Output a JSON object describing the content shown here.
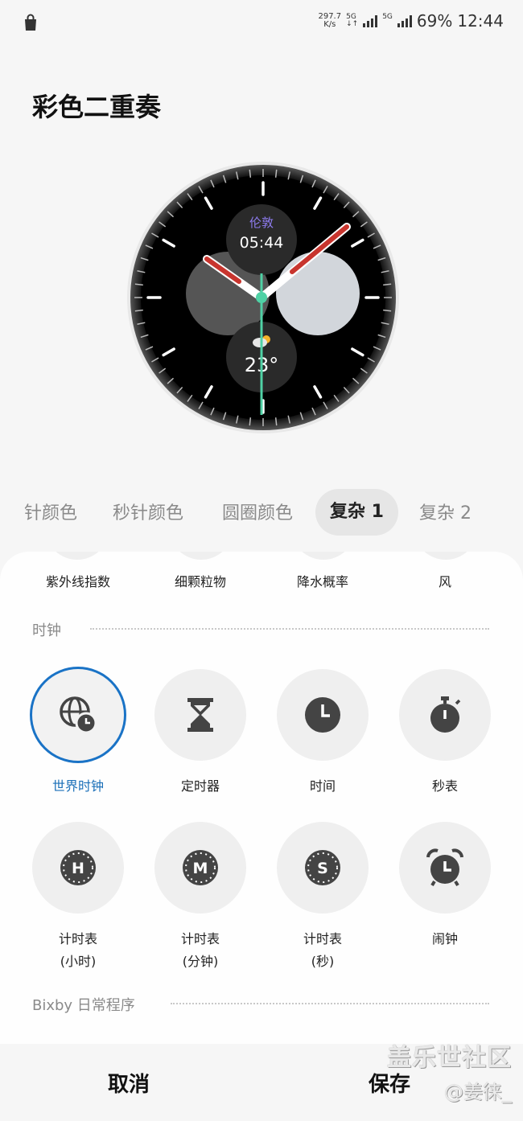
{
  "status_bar": {
    "speed_value": "297.7",
    "speed_unit": "K/s",
    "net1": "5G",
    "net2": "5G",
    "battery": "69%",
    "time": "12:44"
  },
  "page": {
    "title": "彩色二重奏"
  },
  "watch": {
    "city": "伦敦",
    "city_time": "05:44",
    "temperature": "23°",
    "accent_color": "#c8352e",
    "hand_center_color": "#4fd1a5"
  },
  "tabs": [
    {
      "label": "针颜色",
      "active": false
    },
    {
      "label": "秒针颜色",
      "active": false
    },
    {
      "label": "圆圈颜色",
      "active": false
    },
    {
      "label": "复杂 1",
      "active": true
    },
    {
      "label": "复杂 2",
      "active": false
    }
  ],
  "top_row": [
    "紫外线指数",
    "细颗粒物",
    "降水概率",
    "风"
  ],
  "sections": {
    "clock": "时钟",
    "bixby": "Bixby 日常程序"
  },
  "clock_items": [
    {
      "icon": "world-clock-icon",
      "label": "世界时钟",
      "selected": true
    },
    {
      "icon": "hourglass-icon",
      "label": "定时器",
      "selected": false
    },
    {
      "icon": "clock-icon",
      "label": "时间",
      "selected": false
    },
    {
      "icon": "stopwatch-icon",
      "label": "秒表",
      "selected": false
    },
    {
      "icon": "timer-hours-icon",
      "label": "计时表",
      "label2": "(小时)",
      "selected": false
    },
    {
      "icon": "timer-minutes-icon",
      "label": "计时表",
      "label2": "(分钟)",
      "selected": false
    },
    {
      "icon": "timer-seconds-icon",
      "label": "计时表",
      "label2": "(秒)",
      "selected": false
    },
    {
      "icon": "alarm-icon",
      "label": "闹钟",
      "selected": false
    }
  ],
  "footer": {
    "cancel": "取消",
    "save": "保存"
  },
  "watermark": {
    "line1": "盖乐世社区",
    "line2": "@姜徕_"
  },
  "colors": {
    "selected_ring": "#1a73c6",
    "selected_text": "#1a6fb8"
  }
}
